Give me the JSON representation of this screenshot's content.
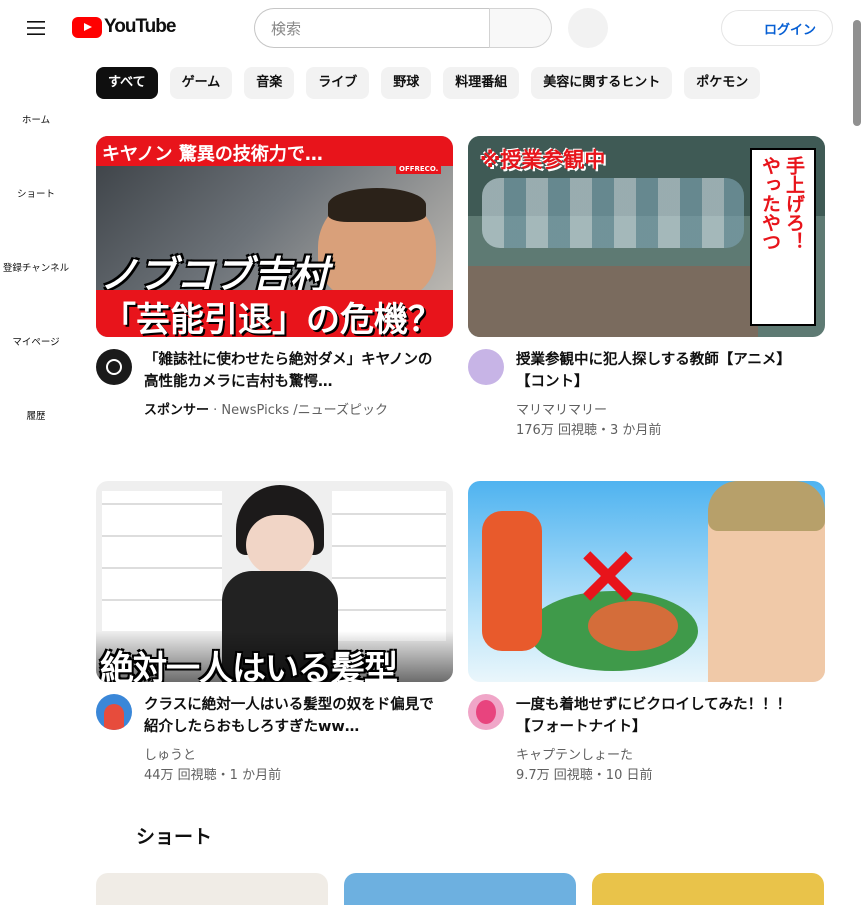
{
  "header": {
    "logo_text": "YouTube",
    "search_placeholder": "検索",
    "login_label": "ログイン"
  },
  "sidebar": {
    "items": [
      {
        "label": "ホーム",
        "icon": "home-icon"
      },
      {
        "label": "ショート",
        "icon": "shorts-icon"
      },
      {
        "label": "登録チャンネル",
        "icon": "subscriptions-icon"
      },
      {
        "label": "マイページ",
        "icon": "you-icon"
      },
      {
        "label": "履歴",
        "icon": "history-icon"
      }
    ]
  },
  "chips": [
    "すべて",
    "ゲーム",
    "音楽",
    "ライブ",
    "野球",
    "料理番組",
    "美容に関するヒント",
    "ポケモン"
  ],
  "videos": [
    {
      "title": "「雑誌社に使わせたら絶対ダメ」キヤノンの高性能カメラに吉村も驚愕…",
      "sponsor": "スポンサー",
      "channel": " · NewsPicks /ニューズピック",
      "stats": "",
      "thumb_texts": [
        "キヤノン 驚異の技術力で…",
        "ノブコブ吉村",
        "「芸能引退」の危機？",
        "OFFRECO."
      ]
    },
    {
      "title": "授業参観中に犯人探しする教師【アニメ】【コント】",
      "channel": "マリマリマリー",
      "stats": "176万 回視聴・3 か月前",
      "thumb_texts": [
        "※授業参観中",
        "やったやつ",
        "手上げろ！"
      ]
    },
    {
      "title": "クラスに絶対一人はいる髪型の奴をド偏見で紹介したらおもしろすぎたww…",
      "channel": "しゅうと",
      "stats": "44万 回視聴・1 か月前",
      "thumb_texts": [
        "絶対一人はいる髪型"
      ]
    },
    {
      "title": "一度も着地せずにビクロイしてみた！！！【フォートナイト】",
      "channel": "キャプテンしょーた",
      "stats": "9.7万 回視聴・10 日前",
      "thumb_texts": []
    }
  ],
  "shorts_section": {
    "title": "ショート"
  },
  "colors": {
    "brand_red": "#ff0000",
    "link_blue": "#065fd4",
    "chip_active": "#0f0f0f",
    "chip_bg": "#f2f2f2"
  }
}
